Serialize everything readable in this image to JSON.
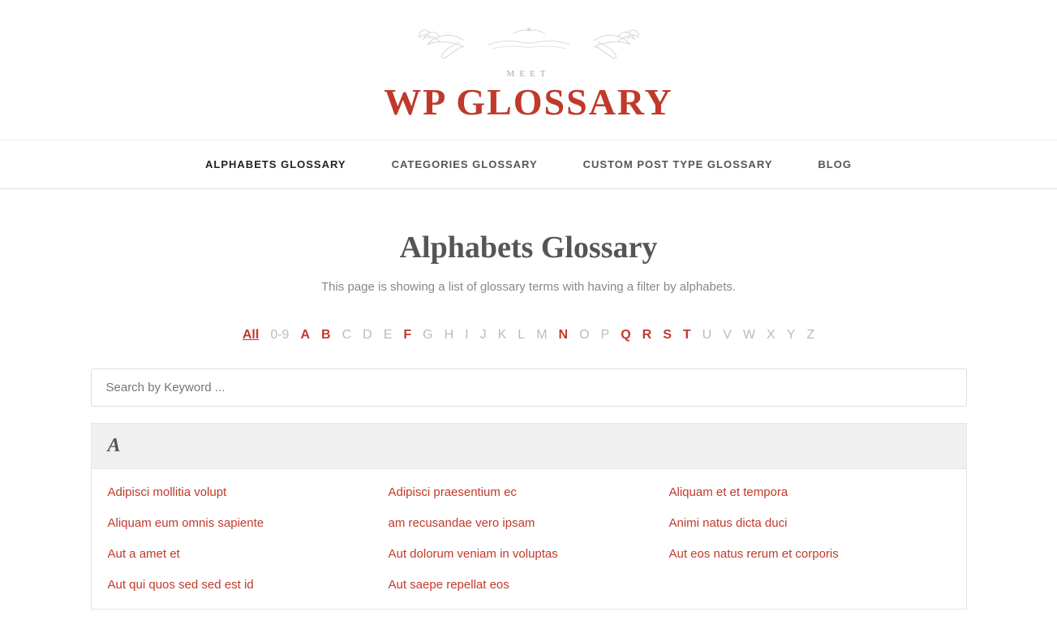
{
  "header": {
    "ornament": "❧ ✦ ❧",
    "meet_label": "MEET",
    "logo_text": "WP GLOSSARY"
  },
  "nav": {
    "items": [
      {
        "id": "alphabets",
        "label": "ALPHABETS GLOSSARY",
        "active": true
      },
      {
        "id": "categories",
        "label": "CATEGORIES GLOSSARY",
        "active": false
      },
      {
        "id": "custom-post",
        "label": "CUSTOM POST TYPE GLOSSARY",
        "active": false
      },
      {
        "id": "blog",
        "label": "BLOG",
        "active": false
      }
    ]
  },
  "page": {
    "title": "Alphabets Glossary",
    "subtitle": "This page is showing a list of glossary terms with having a filter by alphabets."
  },
  "alphabet_filter": {
    "items": [
      {
        "label": "All",
        "active": true,
        "style": "active"
      },
      {
        "label": "0-9",
        "active": false,
        "style": "muted"
      },
      {
        "label": "A",
        "active": false,
        "style": "bold-red"
      },
      {
        "label": "B",
        "active": false,
        "style": "bold-red"
      },
      {
        "label": "C",
        "active": false,
        "style": "muted"
      },
      {
        "label": "D",
        "active": false,
        "style": "muted"
      },
      {
        "label": "E",
        "active": false,
        "style": "muted"
      },
      {
        "label": "F",
        "active": false,
        "style": "bold-red"
      },
      {
        "label": "G",
        "active": false,
        "style": "muted"
      },
      {
        "label": "H",
        "active": false,
        "style": "muted"
      },
      {
        "label": "I",
        "active": false,
        "style": "muted"
      },
      {
        "label": "J",
        "active": false,
        "style": "muted"
      },
      {
        "label": "K",
        "active": false,
        "style": "muted"
      },
      {
        "label": "L",
        "active": false,
        "style": "muted"
      },
      {
        "label": "M",
        "active": false,
        "style": "muted"
      },
      {
        "label": "N",
        "active": false,
        "style": "bold-red"
      },
      {
        "label": "O",
        "active": false,
        "style": "muted"
      },
      {
        "label": "P",
        "active": false,
        "style": "muted"
      },
      {
        "label": "Q",
        "active": false,
        "style": "bold-red"
      },
      {
        "label": "R",
        "active": false,
        "style": "bold-red"
      },
      {
        "label": "S",
        "active": false,
        "style": "bold-red"
      },
      {
        "label": "T",
        "active": false,
        "style": "bold-red"
      },
      {
        "label": "U",
        "active": false,
        "style": "muted"
      },
      {
        "label": "V",
        "active": false,
        "style": "muted"
      },
      {
        "label": "W",
        "active": false,
        "style": "muted"
      },
      {
        "label": "X",
        "active": false,
        "style": "muted"
      },
      {
        "label": "Y",
        "active": false,
        "style": "muted"
      },
      {
        "label": "Z",
        "active": false,
        "style": "muted"
      }
    ]
  },
  "search": {
    "placeholder": "Search by Keyword ..."
  },
  "sections": [
    {
      "letter": "A",
      "terms": [
        "Adipisci mollitia volupt",
        "Adipisci praesentium ec",
        "Aliquam et et tempora",
        "Aliquam eum omnis sapiente",
        "am recusandae vero ipsam",
        "Animi natus dicta duci",
        "Aut a amet et",
        "Aut dolorum veniam in voluptas",
        "Aut eos natus rerum et corporis",
        "Aut qui quos sed sed est id",
        "Aut saepe repellat eos",
        ""
      ]
    }
  ]
}
